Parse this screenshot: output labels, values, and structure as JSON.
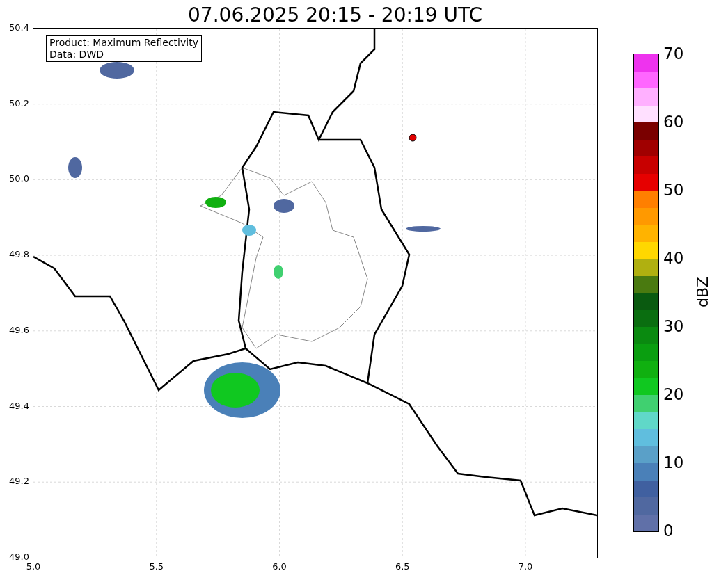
{
  "title": "07.06.2025 20:15 - 20:19 UTC",
  "map": {
    "y_ticks": [
      "50.4",
      "50.2",
      "50.0",
      "49.8",
      "49.6",
      "49.4",
      "49.2",
      "49.0"
    ],
    "x_ticks": [
      "5.0",
      "5.5",
      "6.0",
      "6.5",
      "7.0"
    ],
    "legend": [
      "Product: Maximum Reflectivity",
      "Data: DWD"
    ]
  },
  "colorbar": {
    "label": "dBZ",
    "ticks": [
      "70",
      "60",
      "50",
      "40",
      "30",
      "20",
      "10",
      "0"
    ],
    "bands": [
      {
        "color": "#6070a8"
      },
      {
        "color": "#5068a0"
      },
      {
        "color": "#4060a0"
      },
      {
        "color": "#4a80b8"
      },
      {
        "color": "#5aa0c8"
      },
      {
        "color": "#60bede"
      },
      {
        "color": "#60d8c8"
      },
      {
        "color": "#40d070"
      },
      {
        "color": "#10c820"
      },
      {
        "color": "#10b010"
      },
      {
        "color": "#0a9e10"
      },
      {
        "color": "#0a8a10"
      },
      {
        "color": "#0a6e10"
      },
      {
        "color": "#0a5a10"
      },
      {
        "color": "#4a7a10"
      },
      {
        "color": "#b0b010"
      },
      {
        "color": "#ffd700"
      },
      {
        "color": "#ffb300"
      },
      {
        "color": "#ff9900"
      },
      {
        "color": "#ff7f00"
      },
      {
        "color": "#e60000"
      },
      {
        "color": "#c80000"
      },
      {
        "color": "#a00000"
      },
      {
        "color": "#7a0000"
      },
      {
        "color": "#ffe0ff"
      },
      {
        "color": "#ffb0ff"
      },
      {
        "color": "#ff66ff"
      },
      {
        "color": "#ee33ee"
      }
    ]
  }
}
